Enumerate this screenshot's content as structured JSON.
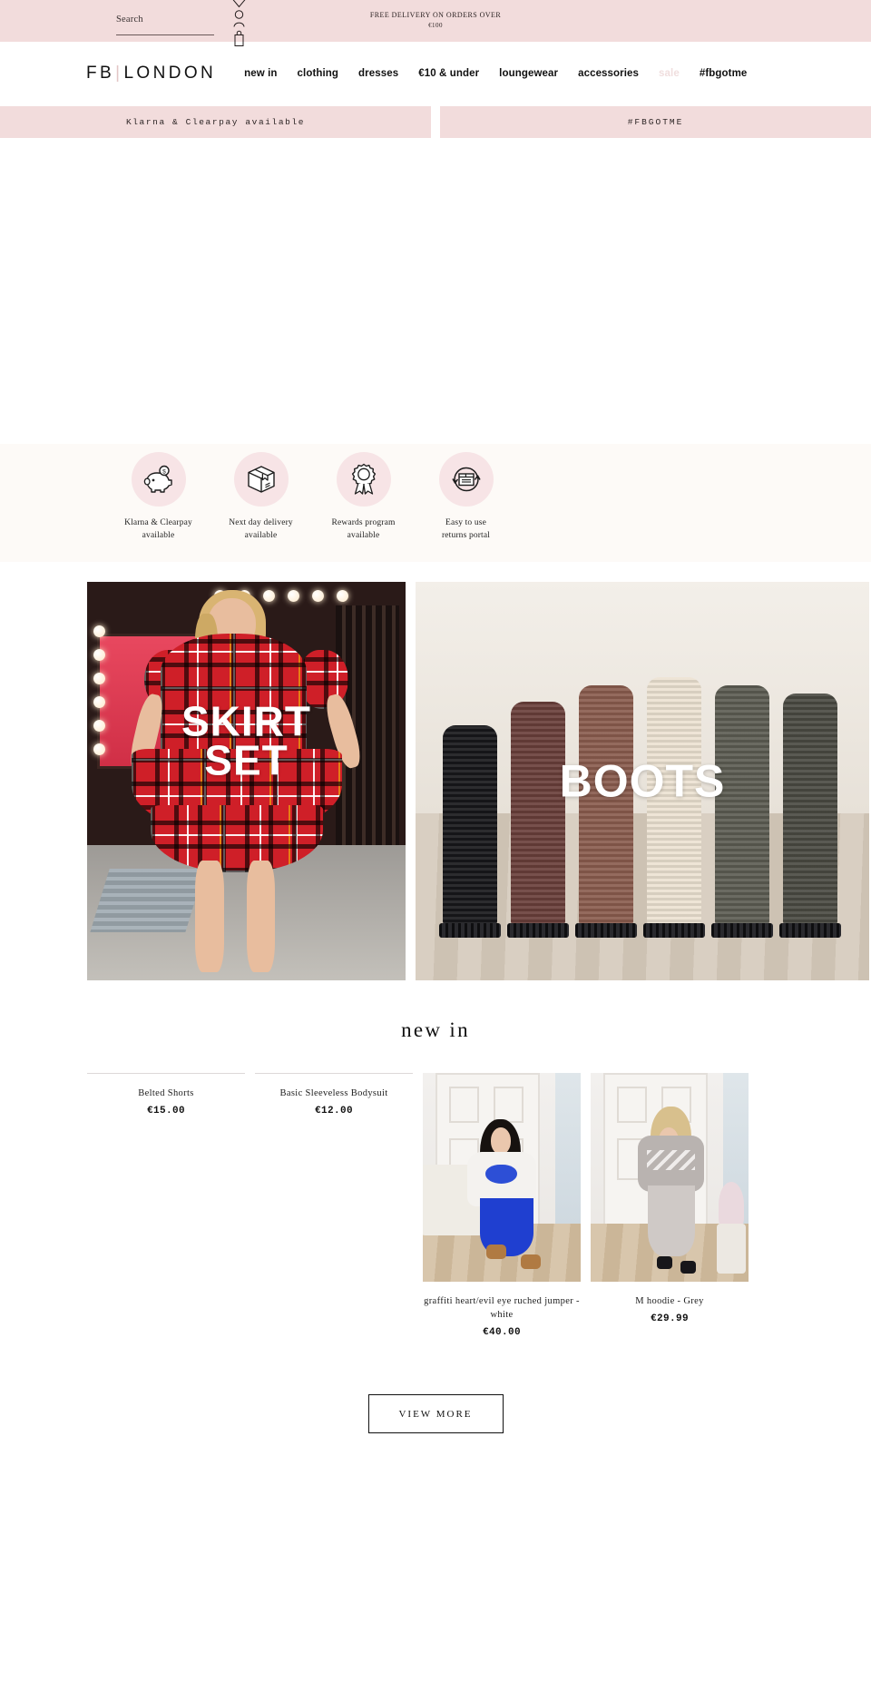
{
  "utility": {
    "search_placeholder": "Search",
    "search_value": "",
    "wishlist_icon": "heart-icon",
    "account_icon": "account-icon",
    "bag_icon": "shopping-bag-icon",
    "free_delivery_line1": "FREE DELIVERY ON ORDERS OVER",
    "free_delivery_line2": "€100"
  },
  "brand": {
    "name_left": "FB",
    "divider": "|",
    "name_right": "LONDON"
  },
  "nav": {
    "items": [
      {
        "label": "new in",
        "muted": false
      },
      {
        "label": "clothing",
        "muted": false
      },
      {
        "label": "dresses",
        "muted": false
      },
      {
        "label": "€10 & under",
        "muted": false
      },
      {
        "label": "loungewear",
        "muted": false
      },
      {
        "label": "accessories",
        "muted": false
      },
      {
        "label": "sale",
        "muted": true
      },
      {
        "label": "#fbgotme",
        "muted": false
      }
    ]
  },
  "announcements": {
    "left": "Klarna & Clearpay available",
    "right": "#FBGOTME"
  },
  "trust_badges": [
    {
      "icon": "piggy-bank-icon",
      "line1": "Klarna & Clearpay",
      "line2": "available"
    },
    {
      "icon": "parcel-box-icon",
      "line1": "Next day delivery",
      "line2": "available"
    },
    {
      "icon": "award-ribbon-icon",
      "line1": "Rewards program",
      "line2": "available"
    },
    {
      "icon": "returns-box-icon",
      "line1": "Easy to use",
      "line2": "returns portal"
    }
  ],
  "banners": [
    {
      "label_line1": "SKIRT",
      "label_line2": "SET",
      "art": "tartan"
    },
    {
      "label_line1": "BOOTS",
      "label_line2": "",
      "art": "boots"
    }
  ],
  "new_in": {
    "title": "new in",
    "products": [
      {
        "title": "Belted Shorts",
        "price": "€15.00",
        "has_image": false
      },
      {
        "title": "Basic Sleeveless Bodysuit",
        "price": "€12.00",
        "has_image": false
      },
      {
        "title": "graffiti heart/evil eye ruched jumper - white",
        "price": "€40.00",
        "has_image": true
      },
      {
        "title": "M hoodie - Grey",
        "price": "€29.99",
        "has_image": true
      }
    ],
    "view_more_label": "VIEW MORE"
  },
  "colors": {
    "pink_bar": "#f2dcdc",
    "badge_circle": "#f7e4e6",
    "trust_strip": "#fdfaf7",
    "muted_nav": "#f0dede",
    "text": "#111111"
  }
}
